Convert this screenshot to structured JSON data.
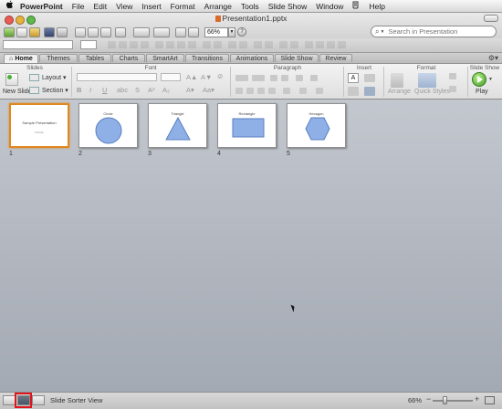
{
  "menubar": {
    "apple": "",
    "items": [
      "PowerPoint",
      "File",
      "Edit",
      "View",
      "Insert",
      "Format",
      "Arrange",
      "Tools",
      "Slide Show",
      "Window",
      "Help"
    ]
  },
  "window": {
    "title": "Presentation1.pptx"
  },
  "toolbar": {
    "zoom": "66%",
    "search_placeholder": "Search in Presentation"
  },
  "ribbon": {
    "tabs": [
      "Home",
      "Themes",
      "Tables",
      "Charts",
      "SmartArt",
      "Transitions",
      "Animations",
      "Slide Show",
      "Review"
    ],
    "active_tab": "Home",
    "groups": {
      "slides": "Slides",
      "font": "Font",
      "paragraph": "Paragraph",
      "insert": "Insert",
      "format": "Format",
      "slideshow": "Slide Show"
    },
    "labels": {
      "new_slide": "New Slide",
      "layout": "Layout",
      "section": "Section",
      "arrange": "Arrange",
      "quick_styles": "Quick Styles",
      "play": "Play"
    }
  },
  "slides": [
    {
      "num": "1",
      "title": "Sample Presentation",
      "subtitle": "Subtitle",
      "shape": "none",
      "selected": true
    },
    {
      "num": "2",
      "title": "Circle",
      "shape": "circle"
    },
    {
      "num": "3",
      "title": "Triangle",
      "shape": "triangle"
    },
    {
      "num": "4",
      "title": "Rectangle",
      "shape": "rectangle"
    },
    {
      "num": "5",
      "title": "Hexagon",
      "shape": "hexagon"
    }
  ],
  "statusbar": {
    "view_name": "Slide Sorter View",
    "zoom": "66%"
  },
  "colors": {
    "selection": "#e08820",
    "shape_fill": "#8fb0e6",
    "shape_stroke": "#5b7fc0",
    "highlight": "#e0141c"
  }
}
